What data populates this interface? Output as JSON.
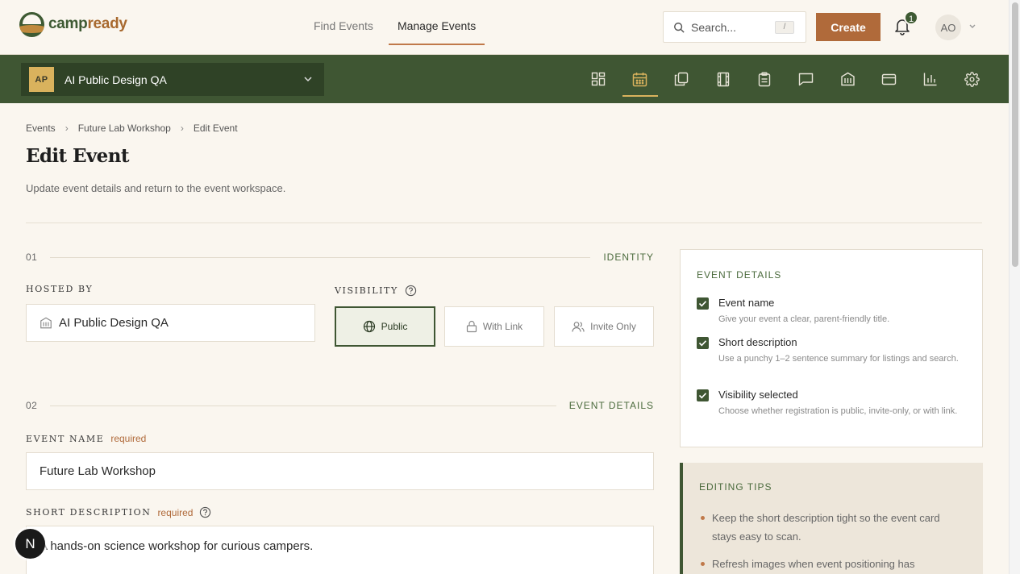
{
  "brand": {
    "part1": "camp",
    "part2": "ready"
  },
  "nav": {
    "links": [
      "Find Events",
      "Manage Events"
    ],
    "active": 1
  },
  "search": {
    "placeholder": "Search...",
    "shortcut": "/"
  },
  "header": {
    "create_label": "Create",
    "notification_count": "1",
    "avatar_initials": "AO"
  },
  "org": {
    "badge": "AP",
    "name": "AI Public Design QA"
  },
  "toolbar": {
    "icons": [
      "dashboard-icon",
      "calendar-icon",
      "copy-icon",
      "film-icon",
      "clipboard-icon",
      "message-icon",
      "building-icon",
      "card-icon",
      "chart-icon",
      "settings-icon"
    ],
    "active": 1
  },
  "breadcrumb": [
    "Events",
    "Future Lab Workshop",
    "Edit Event"
  ],
  "page": {
    "title": "Edit Event",
    "subtitle": "Update event details and return to the event workspace."
  },
  "section1": {
    "num": "01",
    "label": "IDENTITY"
  },
  "section2": {
    "num": "02",
    "label": "EVENT DETAILS"
  },
  "hosted_by": {
    "label": "HOSTED BY",
    "value": "AI Public Design QA"
  },
  "visibility": {
    "label": "VISIBILITY",
    "options": [
      "Public",
      "With Link",
      "Invite Only"
    ],
    "selected": 0
  },
  "event_name": {
    "label": "EVENT NAME",
    "required": "required",
    "value": "Future Lab Workshop"
  },
  "short_description": {
    "label": "SHORT DESCRIPTION",
    "required": "required",
    "value": "A hands-on science workshop for curious campers."
  },
  "event_details_card": {
    "title": "EVENT DETAILS",
    "items": [
      {
        "title": "Event name",
        "desc": "Give your event a clear, parent-friendly title.",
        "checked": true
      },
      {
        "title": "Short description",
        "desc": "Use a punchy 1–2 sentence summary for listings and search.",
        "checked": true
      },
      {
        "title": "Visibility selected",
        "desc": "Choose whether registration is public, invite-only, or with link.",
        "checked": true
      }
    ]
  },
  "editing_tips": {
    "title": "EDITING TIPS",
    "tips": [
      "Keep the short description tight so the event card stays easy to scan.",
      "Refresh images when event positioning has"
    ]
  },
  "fab_label": "N",
  "colors": {
    "brand_green": "#3f5633",
    "accent_orange": "#b06a3a",
    "gold": "#d9b25d",
    "background": "#faf6ef"
  }
}
